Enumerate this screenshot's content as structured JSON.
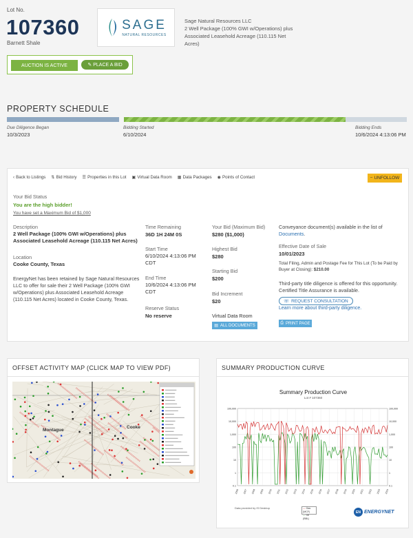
{
  "lot": {
    "label": "Lot No.",
    "number": "107360",
    "area": "Barnett Shale"
  },
  "logo": {
    "word": "SAGE",
    "sub": "NATURAL RESOURCES"
  },
  "seller": {
    "name": "Sage Natural Resources LLC",
    "description": "2 Well Package (100% GWI w/Operations) plus Associated Leasehold Acreage (110.115 Net Acres)"
  },
  "auction": {
    "status": "AUCTION IS ACTIVE",
    "bid_button": "PLACE A BID"
  },
  "schedule": {
    "title": "PROPERTY SCHEDULE",
    "due_label": "Due Diligence Began",
    "due_date": "10/3/2023",
    "start_label": "Bidding Started",
    "start_date": "6/10/2024",
    "end_label": "Bidding Ends",
    "end_date": "10/6/2024 4:13:06 PM"
  },
  "nav": {
    "back": "Back to Listings",
    "history": "Bid History",
    "props": "Properties in this Lot",
    "vdr": "Virtual Data Room",
    "packages": "Data Packages",
    "contacts": "Points of Contact",
    "unfollow": "UNFOLLOW"
  },
  "bid_status": {
    "label": "Your Bid Status",
    "message": "You are the high bidder!",
    "max_note": "You have set a Maximum Bid of $1,000"
  },
  "details": {
    "desc_label": "Description",
    "desc_value": "2 Well Package (100% GWI w/Operations) plus Associated Leasehold Acreage (110.115 Net Acres)",
    "loc_label": "Location",
    "loc_value": "Cooke County, Texas",
    "blurb": "EnergyNet has been retained by Sage Natural Resources LLC to offer for sale their 2 Well Package (100% GWI w/Operations) plus Associated Leasehold Acreage (110.115 Net Acres) located in Cooke County, Texas."
  },
  "times": {
    "remaining_label": "Time Remaining",
    "remaining_value": "36D 1H 24M 0S",
    "start_label": "Start Time",
    "start_value": "6/10/2024 4:13:06 PM CDT",
    "end_label": "End Time",
    "end_value": "10/6/2024 4:13:06 PM CDT",
    "reserve_label": "Reserve Status",
    "reserve_value": "No reserve"
  },
  "bids": {
    "your_label": "Your Bid (Maximum Bid)",
    "your_value": "$280 ($1,000)",
    "highest_label": "Highest Bid",
    "highest_value": "$280",
    "starting_label": "Starting Bid",
    "starting_value": "$200",
    "increment_label": "Bid Increment",
    "increment_value": "$20",
    "vdr_label": "Virtual Data Room",
    "all_docs": "ALL DOCUMENTS"
  },
  "conveyance": {
    "text": "Conveyance document(s) available in the list of",
    "link": "Documents",
    "eff_label": "Effective Date of Sale",
    "eff_value": "10/01/2023",
    "fee_text": "Total Filing, Admin and Postage Fee for This Lot (To be Paid by Buyer at Closing):",
    "fee_value": "$210.00",
    "title_text": "Third-party title diligence is offered for this opportunity. Certified Title Assurance is available.",
    "consult": "REQUEST CONSULTATION",
    "learn": "Learn more about third-party diligence.",
    "print": "PRINT PAGE"
  },
  "map": {
    "title": "OFFSET ACTIVITY MAP (CLICK MAP TO VIEW PDF)",
    "town1": "Montague",
    "town2": "Cooke"
  },
  "curve": {
    "title": "SUMMARY PRODUCTION CURVE",
    "chart_title": "Summary Production Curve",
    "chart_sub": "Lot # 107360",
    "footer": "Data provided by IS Desktop",
    "legend_gas": "Gas (MCF)",
    "legend_oil": "Oil (BBL)",
    "brand": "ENERGYNET",
    "brand_badge": "EN"
  },
  "colors": {
    "navy": "#1d3557",
    "green": "#7cb342",
    "gold": "#f2b51b",
    "blue": "#5aa9d9"
  }
}
